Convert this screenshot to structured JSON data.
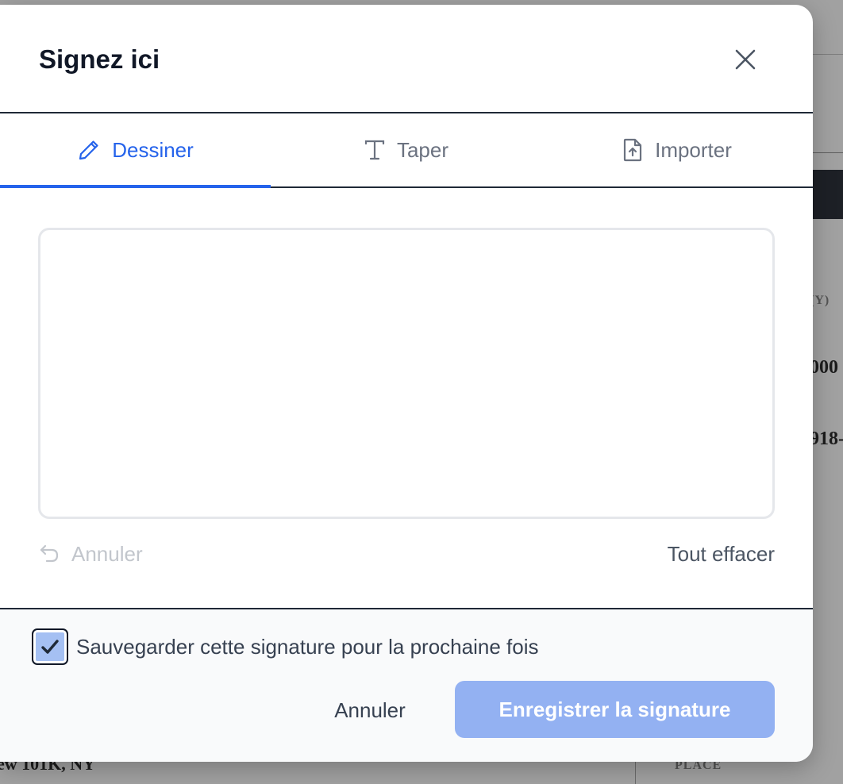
{
  "background": {
    "label": "(Y)",
    "value1": "000",
    "value2": "918-",
    "city": "ew 101K, NY",
    "place": "PLACE"
  },
  "modal": {
    "title": "Signez ici",
    "close_icon": "close-icon"
  },
  "tabs": [
    {
      "label": "Dessiner",
      "icon": "pencil-icon",
      "active": true
    },
    {
      "label": "Taper",
      "icon": "text-type-icon",
      "active": false
    },
    {
      "label": "Importer",
      "icon": "file-upload-icon",
      "active": false
    }
  ],
  "draw": {
    "undo_label": "Annuler",
    "clear_label": "Tout effacer"
  },
  "footer": {
    "save_checkbox_label": "Sauvegarder cette signature pour la prochaine fois",
    "save_checked": true,
    "cancel_label": "Annuler",
    "submit_label": "Enregistrer la signature"
  },
  "colors": {
    "accent": "#2563eb",
    "submit_disabled": "#93b1f2",
    "checkbox_fill": "#a5c0f3"
  }
}
